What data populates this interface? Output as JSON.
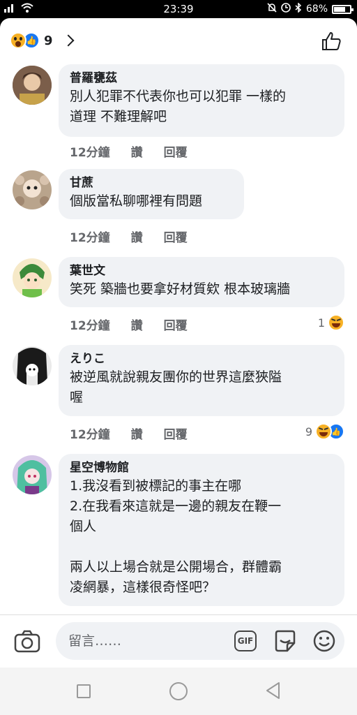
{
  "status_bar": {
    "time": "23:39",
    "battery": "68%"
  },
  "header": {
    "reaction_count": "9"
  },
  "comments": [
    {
      "author": "普羅甕茲",
      "text": "別人犯罪不代表你也可以犯罪 一樣的\n道理 不難理解吧",
      "time": "12分鐘",
      "like": "讚",
      "reply": "回覆",
      "reactions": ""
    },
    {
      "author": "甘蔗",
      "text": "個版當私聊哪裡有問題",
      "time": "12分鐘",
      "like": "讚",
      "reply": "回覆",
      "reactions": ""
    },
    {
      "author": "葉世文",
      "text": "笑死 築牆也要拿好材質欸 根本玻璃牆",
      "time": "12分鐘",
      "like": "讚",
      "reply": "回覆",
      "reactions": "1"
    },
    {
      "author": "えりこ",
      "text": "被逆風就說親友團你的世界這麼狹隘\n喔",
      "time": "12分鐘",
      "like": "讚",
      "reply": "回覆",
      "reactions": "9"
    },
    {
      "author": "星空博物館",
      "text": "1.我沒看到被標記的事主在哪\n2.在我看來這就是一邊的親友在鞭一\n個人\n\n兩人以上場合就是公開場合，群體霸\n凌網暴，這樣很奇怪吧？",
      "time": "",
      "like": "",
      "reply": "",
      "reactions": ""
    }
  ],
  "composer": {
    "placeholder": "留言……",
    "gif_label": "GIF"
  },
  "colors": {
    "bubble": "#f0f2f5",
    "like_blue": "#1877f2",
    "emoji_yellow": "#f7b125"
  }
}
